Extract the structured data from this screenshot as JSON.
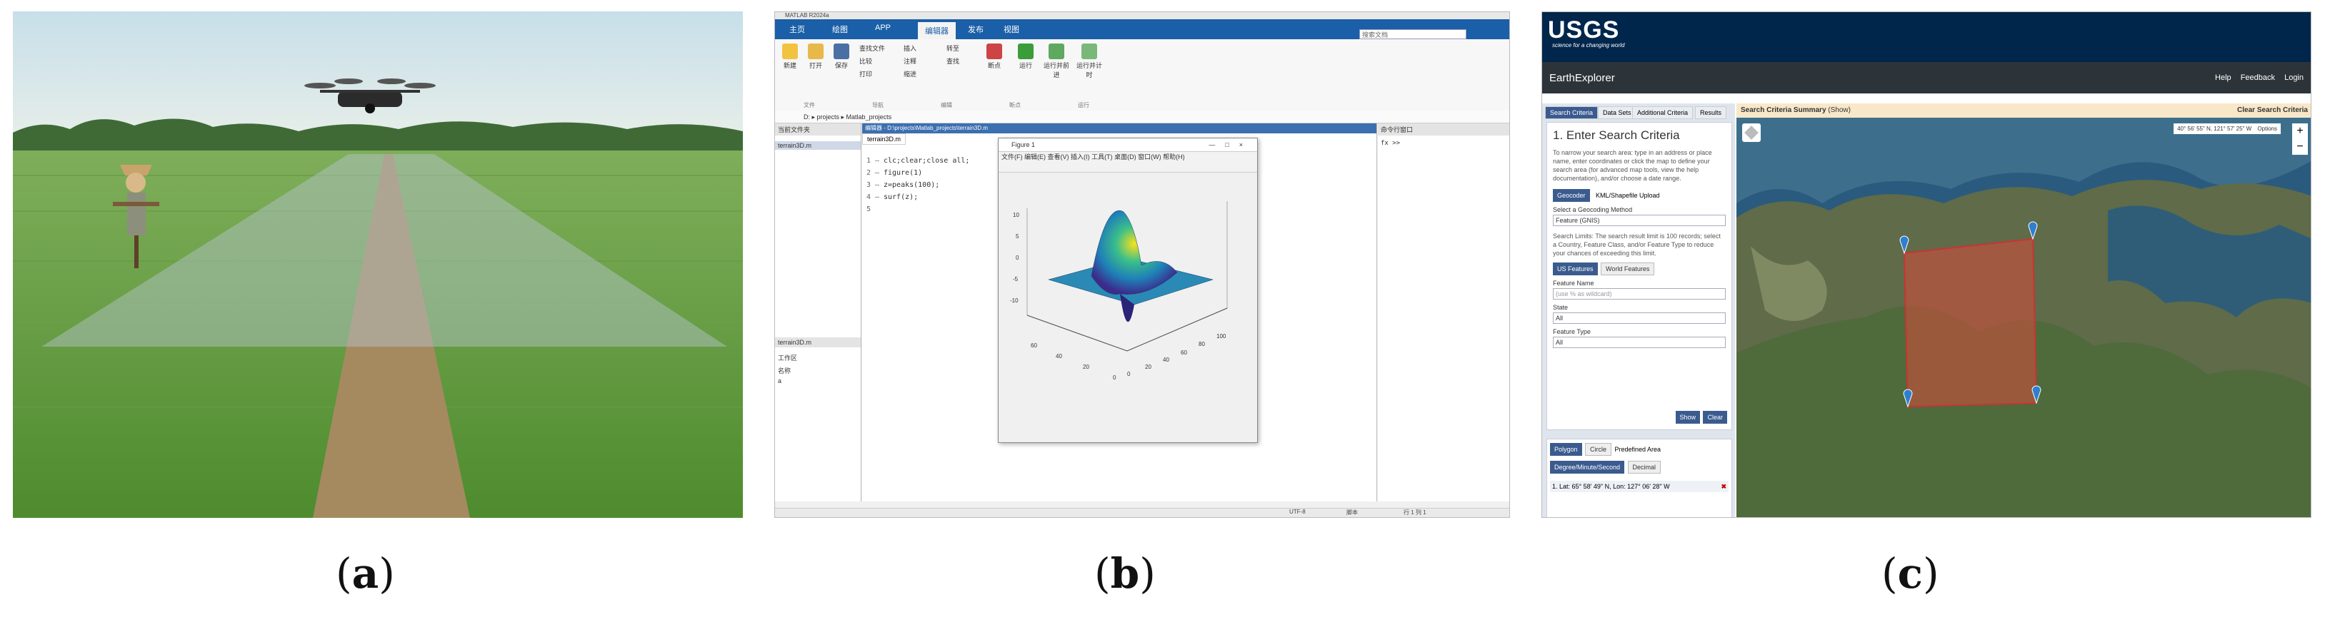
{
  "captions": {
    "a": "a",
    "b": "b",
    "c": "c"
  },
  "panel_b": {
    "window_title": "MATLAB R2024a",
    "tabs": [
      "主页",
      "绘图",
      "APP",
      "编辑器",
      "发布",
      "视图"
    ],
    "active_tab": "编辑器",
    "search_placeholder": "搜索文档",
    "ribbon_groups": [
      "文件",
      "导航",
      "编辑",
      "断点",
      "运行"
    ],
    "ribbon_buttons": [
      "新建",
      "打开",
      "保存",
      "查找文件",
      "比较",
      "打印",
      "插入",
      "注释",
      "缩进",
      "转至",
      "查找",
      "断点",
      "运行",
      "运行并前进",
      "运行并计时"
    ],
    "address": "D: ▸ projects ▸ Matlab_projects",
    "left_panel": {
      "header": "当前文件夹",
      "file": "terrain3D.m",
      "workspace_header": "terrain3D.m",
      "workspace_label": "工作区",
      "var_header": "名称",
      "var": "a"
    },
    "editor": {
      "header": "编辑器 - D:\\projects\\Matlab_projects\\terrain3D.m",
      "tab": "terrain3D.m",
      "lines": [
        "clc;clear;close all;",
        "figure(1)",
        "z=peaks(100);",
        "surf(z);",
        ""
      ]
    },
    "command_window": {
      "header": "命令行窗口",
      "prompt": "fx >>"
    },
    "figure": {
      "title": "Figure 1",
      "menu": [
        "文件(F)",
        "编辑(E)",
        "查看(V)",
        "插入(I)",
        "工具(T)",
        "桌面(D)",
        "窗口(W)",
        "帮助(H)"
      ],
      "z_ticks": [
        "10",
        "5",
        "0",
        "-5",
        "-10"
      ],
      "x_ticks": [
        "0",
        "20",
        "40",
        "60"
      ],
      "y_ticks": [
        "0",
        "20",
        "40",
        "60",
        "80",
        "100"
      ]
    },
    "status": [
      "UTF-8",
      "脚本",
      "行 1 列 1"
    ]
  },
  "panel_c": {
    "logo": "USGS",
    "tagline": "science for a changing world",
    "app_title": "EarthExplorer",
    "nav_links": [
      "Help",
      "Feedback",
      "Login"
    ],
    "side_tabs": [
      "Search Criteria",
      "Data Sets",
      "Additional Criteria",
      "Results"
    ],
    "heading": "1. Enter Search Criteria",
    "intro": "To narrow your search area: type in an address or place name, enter coordinates or click the map to define your search area (for advanced map tools, view the help documentation), and/or choose a date range.",
    "subtabs": [
      "Geocoder",
      "KML/Shapefile Upload"
    ],
    "geocoding_label": "Select a Geocoding Method",
    "geocoding_value": "Feature (GNIS)",
    "search_limits": "Search Limits: The search result limit is 100 records; select a Country, Feature Class, and/or Feature Type to reduce your chances of exceeding this limit.",
    "feature_buttons": [
      "US Features",
      "World Features"
    ],
    "feature_name_label": "Feature Name",
    "feature_name_placeholder": "(use % as wildcard)",
    "state_label": "State",
    "state_value": "All",
    "feature_type_label": "Feature Type",
    "feature_type_value": "All",
    "action_buttons": [
      "Show",
      "Clear"
    ],
    "area_tabs": [
      "Polygon",
      "Circle",
      "Predefined Area"
    ],
    "area_buttons": [
      "Degree/Minute/Second",
      "Decimal"
    ],
    "coordinate_row": "1. Lat: 65° 58' 49\" N, Lon: 127° 06' 28\" W",
    "map_header_title": "Search Criteria Summary",
    "map_header_toggle": "(Show)",
    "map_header_clear": "Clear Search Criteria",
    "coord_readout": "40° 56' 55\" N, 121° 57' 25\" W",
    "options_label": "Options",
    "zoom_in": "+",
    "zoom_out": "−"
  }
}
